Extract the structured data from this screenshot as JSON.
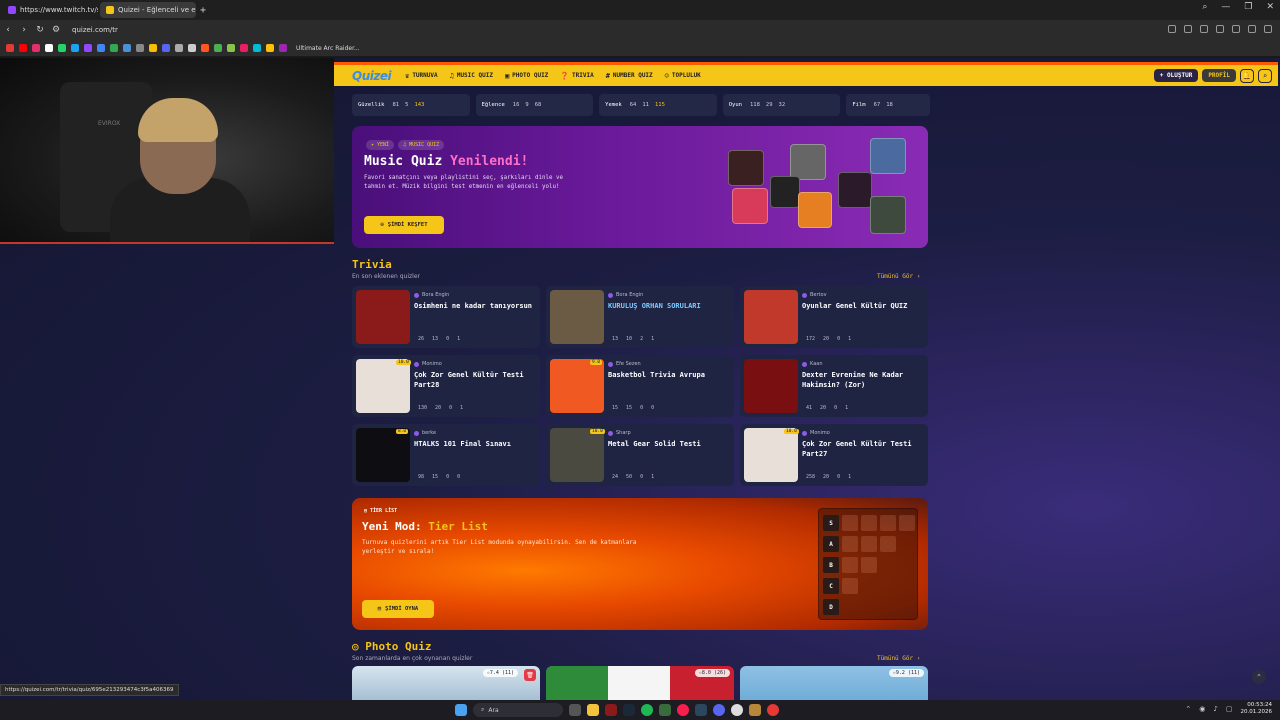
{
  "browser": {
    "tabs": [
      {
        "label": "https://www.twitch.tv/so",
        "favicon_color": "#9146ff",
        "active": false
      },
      {
        "label": "Quizei - Eğlenceli ve etki",
        "favicon_color": "#f5c518",
        "active": true
      }
    ],
    "new_tab": "+",
    "url": "quizei.com/tr",
    "bookmark_label": "Ultimate Arc Raider...",
    "window_controls": [
      "⌕",
      "—",
      "❐",
      "✕"
    ]
  },
  "webcam": {
    "label": "EVIROX"
  },
  "nav": {
    "logo": "Quizei",
    "links": [
      {
        "icon": "♛",
        "label": "TURNUVA"
      },
      {
        "icon": "♫",
        "label": "MUSIC QUIZ"
      },
      {
        "icon": "▣",
        "label": "PHOTO QUIZ"
      },
      {
        "icon": "❓",
        "label": "TRIVIA"
      },
      {
        "icon": "#",
        "label": "NUMBER QUIZ"
      },
      {
        "icon": "☺",
        "label": "TOPLULUK"
      }
    ],
    "create_label": "+ OLUŞTUR",
    "profile_label": "PROFİL",
    "bell_icon": "🔔",
    "search_icon": "⌕"
  },
  "categories": [
    {
      "name": "Güzellik",
      "a": "81",
      "b": "5",
      "c": "143"
    },
    {
      "name": "Eğlence",
      "a": "16",
      "b": "9",
      "c": "68"
    },
    {
      "name": "Yemek",
      "a": "64",
      "b": "11",
      "c": "115"
    },
    {
      "name": "Oyun",
      "a": "118",
      "b": "29",
      "c": "32"
    },
    {
      "name": "Film",
      "a": "67",
      "b": "18",
      "c": ""
    }
  ],
  "music_banner": {
    "badges": [
      "✦ YENİ",
      "♫ MUSIC QUIZ"
    ],
    "title_plain": "Music Quiz ",
    "title_highlight": "Yenilendi!",
    "description": "Favori sanatçını veya playlistini seç, şarkıları dinle ve tahmin et. Müzik bilgini test etmenin en eğlenceli yolu!",
    "cta": "ŞİMDİ KEŞFET"
  },
  "trivia": {
    "title": "Trivia",
    "subtitle": "En son eklenen quizler",
    "see_all": "Tümünü Gör ›",
    "quizzes": [
      {
        "author": "Bora Engin",
        "title": "Osimheni ne kadar tanıyorsun",
        "rating": "",
        "s1": "26",
        "s2": "13",
        "s3": "0",
        "s4": "1",
        "thumb": "#8b1a1a",
        "hover": false
      },
      {
        "author": "Bora Engin",
        "title": "KURULUŞ ORHAN SORULARI",
        "rating": "",
        "s1": "13",
        "s2": "10",
        "s3": "2",
        "s4": "1",
        "thumb": "#6b5a44",
        "hover": true
      },
      {
        "author": "Bertov",
        "title": "Oyunlar Genel Kültür QUIZ",
        "rating": "",
        "s1": "172",
        "s2": "20",
        "s3": "0",
        "s4": "1",
        "thumb": "#c0392b",
        "hover": false
      },
      {
        "author": "Monimo",
        "title": "Çok Zor Genel Kültür Testi Part28",
        "rating": "10.0",
        "s1": "130",
        "s2": "20",
        "s3": "0",
        "s4": "1",
        "thumb": "#e8e0d8",
        "hover": false
      },
      {
        "author": "Efe Sezen",
        "title": "Basketbol Trivia Avrupa",
        "rating": "9.0",
        "s1": "15",
        "s2": "15",
        "s3": "0",
        "s4": "0",
        "thumb": "#f05a22",
        "hover": false
      },
      {
        "author": "Kaan",
        "title": "Dexter Evrenine Ne Kadar Hakimsin? (Zor)",
        "rating": "",
        "s1": "41",
        "s2": "20",
        "s3": "0",
        "s4": "1",
        "thumb": "#7a0f12",
        "hover": false
      },
      {
        "author": "berke",
        "title": "HTALKS 101 Final Sınavı",
        "rating": "8.0",
        "s1": "98",
        "s2": "15",
        "s3": "0",
        "s4": "0",
        "thumb": "#0e0e12",
        "hover": false
      },
      {
        "author": "Sharp",
        "title": "Metal Gear Solid Testi",
        "rating": "10.0",
        "s1": "24",
        "s2": "50",
        "s3": "0",
        "s4": "1",
        "thumb": "#4a4a40",
        "hover": false
      },
      {
        "author": "Monimo",
        "title": "Çok Zor Genel Kültür Testi Part27",
        "rating": "10.0",
        "s1": "258",
        "s2": "20",
        "s3": "0",
        "s4": "1",
        "thumb": "#e8e0d8",
        "hover": false
      }
    ]
  },
  "tier_list": {
    "tag": "TİER LİST",
    "title_plain": "Yeni Mod: ",
    "title_highlight": "Tier List",
    "description": "Turnuva quizlerini artık Tier List modunda oynayabilirsin. Sen de katmanlara yerleştir ve sırala!",
    "cta": "ŞİMDİ OYNA",
    "rows": [
      {
        "label": "S",
        "cells": 4
      },
      {
        "label": "A",
        "cells": 3
      },
      {
        "label": "B",
        "cells": 2
      },
      {
        "label": "C",
        "cells": 1
      },
      {
        "label": "D",
        "cells": 0
      }
    ]
  },
  "photo_quiz": {
    "title": "Photo Quiz",
    "subtitle": "Son zamanlarda en çok oynanan quizler",
    "see_all": "Tümünü Gör ›",
    "cards": [
      {
        "rating": "☆7.4 (11)",
        "bg": "#9fb9cf"
      },
      {
        "rating": "☆8.0 (26)",
        "bg": "#2e8b3a"
      },
      {
        "rating": "☆9.2 (11)",
        "bg": "#6aa9d6"
      }
    ]
  },
  "status_url": "https://quizei.com/tr/trivia/quiz/695e213293474c3f5a406369",
  "taskbar": {
    "search": "Ara",
    "time": "00:53:24",
    "date": "20.01.2026"
  }
}
